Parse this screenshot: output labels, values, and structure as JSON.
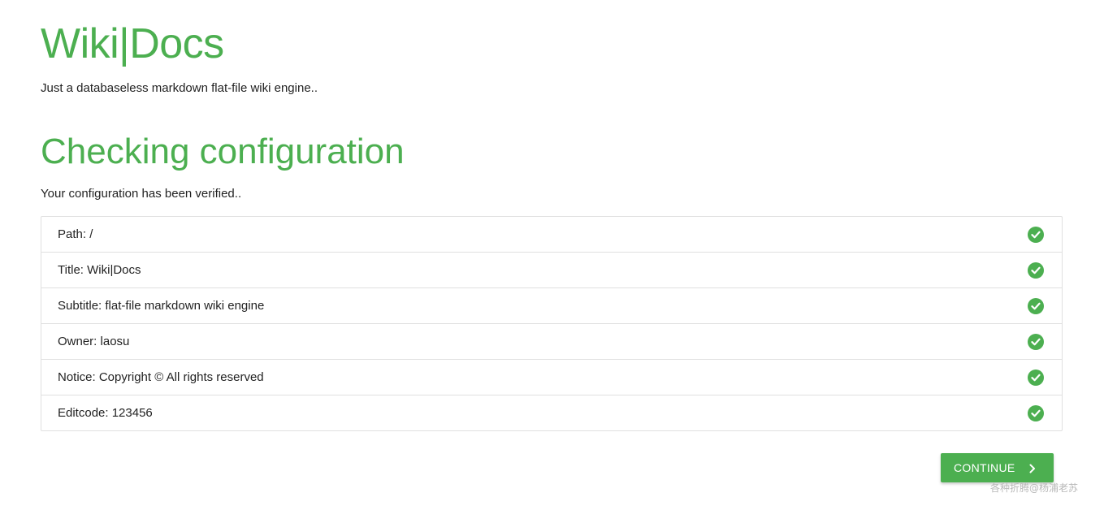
{
  "header": {
    "brand": "Wiki|Docs",
    "tagline": "Just a databaseless markdown flat-file wiki engine.."
  },
  "main": {
    "title": "Checking configuration",
    "status": "Your configuration has been verified..",
    "items": [
      {
        "label": "Path: /",
        "icon": "check-circle-icon"
      },
      {
        "label": "Title: Wiki|Docs",
        "icon": "check-circle-icon"
      },
      {
        "label": "Subtitle: flat-file markdown wiki engine",
        "icon": "check-circle-icon"
      },
      {
        "label": "Owner: laosu",
        "icon": "check-circle-icon"
      },
      {
        "label": "Notice: Copyright © All rights reserved",
        "icon": "check-circle-icon"
      },
      {
        "label": "Editcode: 123456",
        "icon": "check-circle-icon"
      }
    ],
    "continue_label": "CONTINUE"
  },
  "watermark": "各种折腾@杨浦老苏",
  "colors": {
    "accent": "#4caf50",
    "border": "#e0e0e0",
    "text": "#222222"
  }
}
